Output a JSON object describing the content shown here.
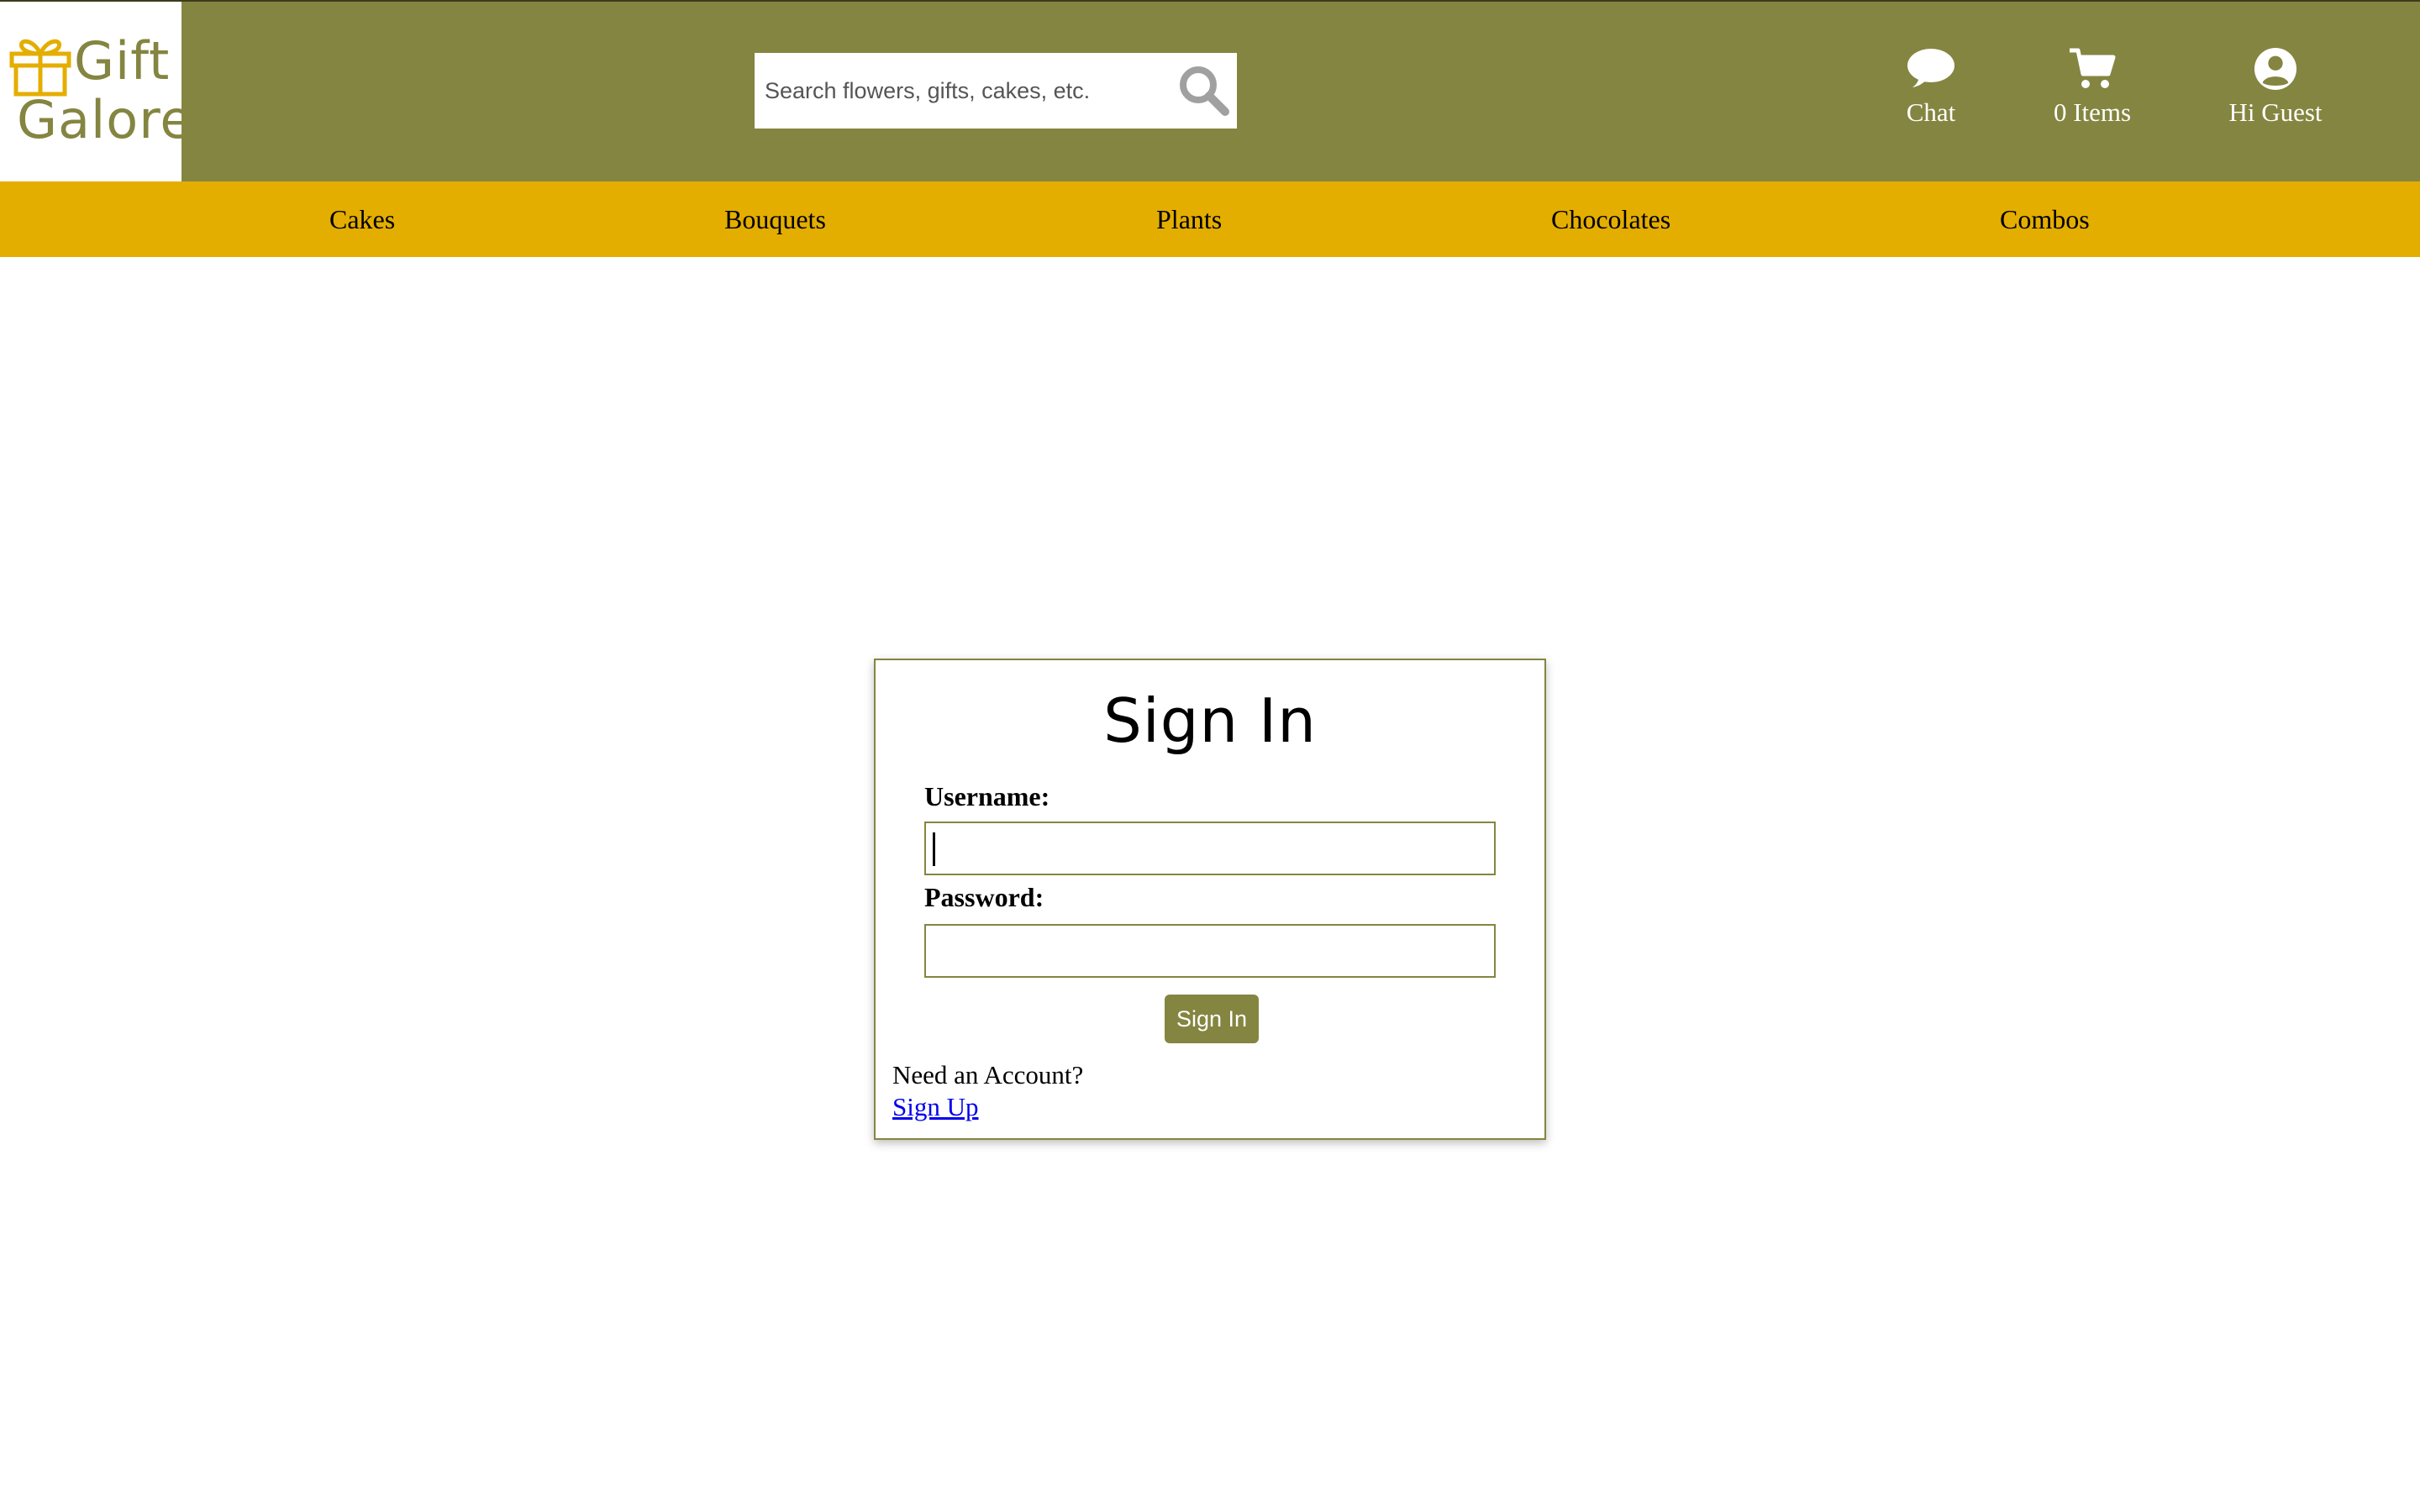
{
  "brand": {
    "line1": "Gift",
    "line2": "Galore",
    "logo_icon": "gift-icon",
    "colors": {
      "primary": "#848540",
      "accent": "#e4ae00"
    }
  },
  "search": {
    "placeholder": "Search flowers, gifts, cakes, etc.",
    "icon": "search-icon"
  },
  "header_actions": {
    "chat": {
      "label": "Chat",
      "icon": "chat-icon"
    },
    "cart": {
      "label": "0 Items",
      "icon": "cart-icon"
    },
    "user": {
      "label": "Hi Guest",
      "icon": "user-icon"
    }
  },
  "nav": {
    "items": [
      "Cakes",
      "Bouquets",
      "Plants",
      "Chocolates",
      "Combos"
    ]
  },
  "signin": {
    "title": "Sign In",
    "username_label": "Username:",
    "username_value": "",
    "password_label": "Password:",
    "password_value": "",
    "button_label": "Sign In",
    "need_account": "Need an Account?",
    "signup_link": "Sign Up"
  }
}
